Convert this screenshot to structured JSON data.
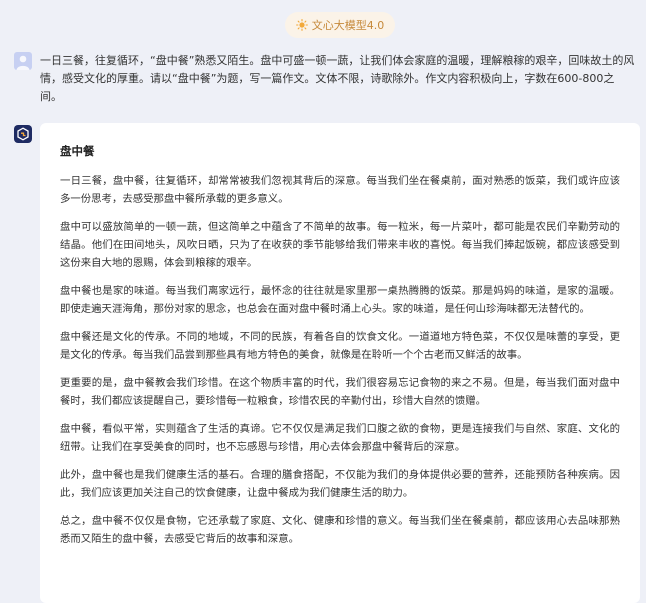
{
  "header": {
    "model_label": "文心大模型4.0"
  },
  "user": {
    "prompt": "一日三餐，往复循环，“盘中餐”熟悉又陌生。盘中可盛一顿一蔬，让我们体会家庭的温暖，理解粮稼的艰辛，回味故土的风情，感受文化的厚重。请以“盘中餐”为题，写一篇作文。文体不限，诗歌除外。作文内容积极向上，字数在600-800之间。"
  },
  "response": {
    "title": "盘中餐",
    "paragraphs": [
      "一日三餐，盘中餐，往复循环，却常常被我们忽视其背后的深意。每当我们坐在餐桌前，面对熟悉的饭菜，我们或许应该多一份思考，去感受那盘中餐所承载的更多意义。",
      "盘中可以盛放简单的一顿一蔬，但这简单之中蕴含了不简单的故事。每一粒米，每一片菜叶，都可能是农民们辛勤劳动的结晶。他们在田间地头，风吹日晒，只为了在收获的季节能够给我们带来丰收的喜悦。每当我们捧起饭碗，都应该感受到这份来自大地的恩赐，体会到粮稼的艰辛。",
      "盘中餐也是家的味道。每当我们离家远行，最怀念的往往就是家里那一桌热腾腾的饭菜。那是妈妈的味道，是家的温暖。即使走遍天涯海角，那份对家的思念，也总会在面对盘中餐时涌上心头。家的味道，是任何山珍海味都无法替代的。",
      "盘中餐还是文化的传承。不同的地域，不同的民族，有着各自的饮食文化。一道道地方特色菜，不仅仅是味蕾的享受，更是文化的传承。每当我们品尝到那些具有地方特色的美食，就像是在聆听一个个古老而又鲜活的故事。",
      "更重要的是，盘中餐教会我们珍惜。在这个物质丰富的时代，我们很容易忘记食物的来之不易。但是，每当我们面对盘中餐时，我们都应该提醒自己，要珍惜每一粒粮食，珍惜农民的辛勤付出，珍惜大自然的馈赠。",
      "盘中餐，看似平常，实则蕴含了生活的真谛。它不仅仅是满足我们口腹之欲的食物，更是连接我们与自然、家庭、文化的纽带。让我们在享受美食的同时，也不忘感恩与珍惜，用心去体会那盘中餐背后的深意。",
      "此外，盘中餐也是我们健康生活的基石。合理的膳食搭配，不仅能为我们的身体提供必要的营养，还能预防各种疾病。因此，我们应该更加关注自己的饮食健康，让盘中餐成为我们健康生活的助力。",
      "总之，盘中餐不仅仅是食物，它还承载了家庭、文化、健康和珍惜的意义。每当我们坐在餐桌前，都应该用心去品味那熟悉而又陌生的盘中餐，去感受它背后的故事和深意。"
    ]
  },
  "colors": {
    "background": "#eef0f7",
    "badge_bg": "#fbf3e8",
    "badge_text": "#c68a3c",
    "bot_avatar": "#1e2b63",
    "user_avatar": "#c7d0f2"
  },
  "icons": {
    "model": "sun-icon",
    "user": "user-avatar",
    "bot": "ernie-bot-avatar"
  }
}
